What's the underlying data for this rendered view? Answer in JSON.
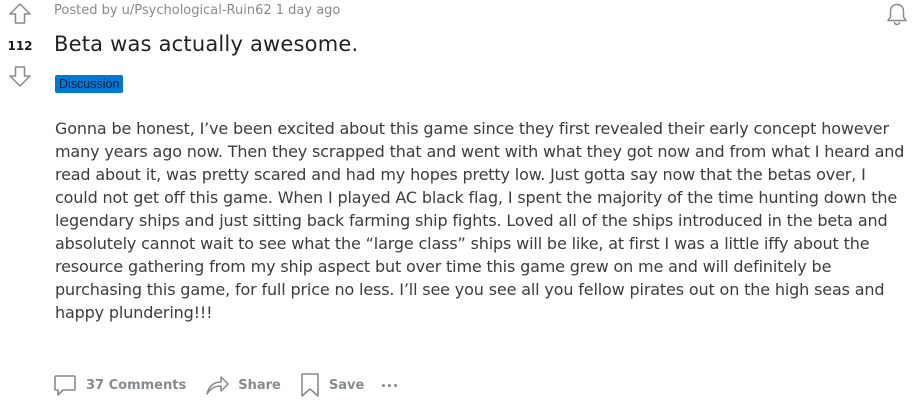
{
  "post": {
    "meta": "Posted by u/Psychological-Ruin62 1 day ago",
    "score": "112",
    "title": "Beta was actually awesome.",
    "flair": "Discussion",
    "flair_color": "#0079d3",
    "body": "Gonna be honest, I’ve been excited about this game since they first revealed their early concept however many years ago now. Then they scrapped that and went with what they got now and from what I heard and read about it, was pretty scared and had my hopes pretty low. Just gotta say now that the betas over, I could not get off this game. When I played AC black flag, I spent the majority of the time hunting down the legendary ships and just sitting back farming ship fights. Loved all of the ships introduced in the beta and absolutely cannot wait to see what the “large class” ships will be like, at first I was a little iffy about the resource gathering from my ship aspect but over time this game grew on me and will definitely be purchasing this game, for full price no less. I’ll see you see all you fellow pirates out on the high seas and happy plundering!!!"
  },
  "actions": {
    "comments_label": "37 Comments",
    "share_label": "Share",
    "save_label": "Save"
  },
  "icons": {
    "upvote": "upvote-arrow-icon",
    "downvote": "downvote-arrow-icon",
    "bell": "bell-icon",
    "comment": "comment-bubble-icon",
    "share": "share-arrow-icon",
    "save": "bookmark-icon",
    "more": "more-dots-icon"
  }
}
